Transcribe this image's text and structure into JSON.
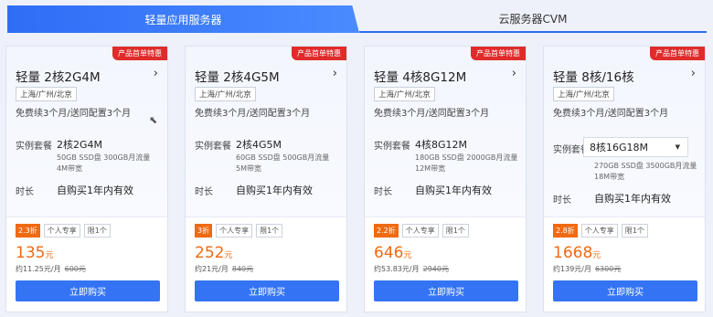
{
  "tabs": {
    "active": "轻量应用服务器",
    "inactive": "云服务器CVM"
  },
  "labels": {
    "spec": "实例套餐",
    "duration": "时长",
    "buy": "立即购买",
    "monthly_prefix": "约",
    "price_unit": "元"
  },
  "icons": {
    "chevron": "chevron-right-icon",
    "caret": "caret-down-icon",
    "cursor": "cursor-icon"
  },
  "colors": {
    "accent": "#3474f4",
    "price": "#f06a12",
    "badge": "#e02b2b"
  },
  "cards": [
    {
      "badge": "产品首单特惠",
      "title": "轻量 2核2G4M",
      "region": "上海/广州/北京",
      "promo": "免费续3个月/送同配置3个月",
      "spec_value": "2核2G4M",
      "spec_detail": "50GB SSD盘 300GB月流量 4M带宽",
      "duration_value": "自购买1年内有效",
      "discount": "2.3折",
      "tag1": "个人专享",
      "tag2": "限1个",
      "price": "135",
      "monthly": "约11.25元/月",
      "original": "600元"
    },
    {
      "badge": "产品首单特惠",
      "title": "轻量 2核4G5M",
      "region": "上海/广州/北京",
      "promo": "免费续3个月/送同配置3个月",
      "spec_value": "2核4G5M",
      "spec_detail": "60GB SSD盘 500GB月流量 5M带宽",
      "duration_value": "自购买1年内有效",
      "discount": "3折",
      "tag1": "个人专享",
      "tag2": "限1个",
      "price": "252",
      "monthly": "约21元/月",
      "original": "840元"
    },
    {
      "badge": "产品首单特惠",
      "title": "轻量 4核8G12M",
      "region": "上海/广州/北京",
      "promo": "免费续3个月/送同配置3个月",
      "spec_value": "4核8G12M",
      "spec_detail": "180GB SSD盘 2000GB月流量 12M带宽",
      "duration_value": "自购买1年内有效",
      "discount": "2.2折",
      "tag1": "个人专享",
      "tag2": "限1个",
      "price": "646",
      "monthly": "约53.83元/月",
      "original": "2940元"
    },
    {
      "badge": "产品首单特惠",
      "title": "轻量 8核/16核",
      "region": "上海/广州/北京",
      "promo": "免费续3个月/送同配置3个月",
      "spec_value": "8核16G18M",
      "spec_detail": "270GB SSD盘 3500GB月流量 18M带宽",
      "duration_value": "自购买1年内有效",
      "discount": "2.8折",
      "tag1": "个人专享",
      "tag2": "限1个",
      "price": "1668",
      "monthly": "约139元/月",
      "original": "6300元"
    }
  ]
}
